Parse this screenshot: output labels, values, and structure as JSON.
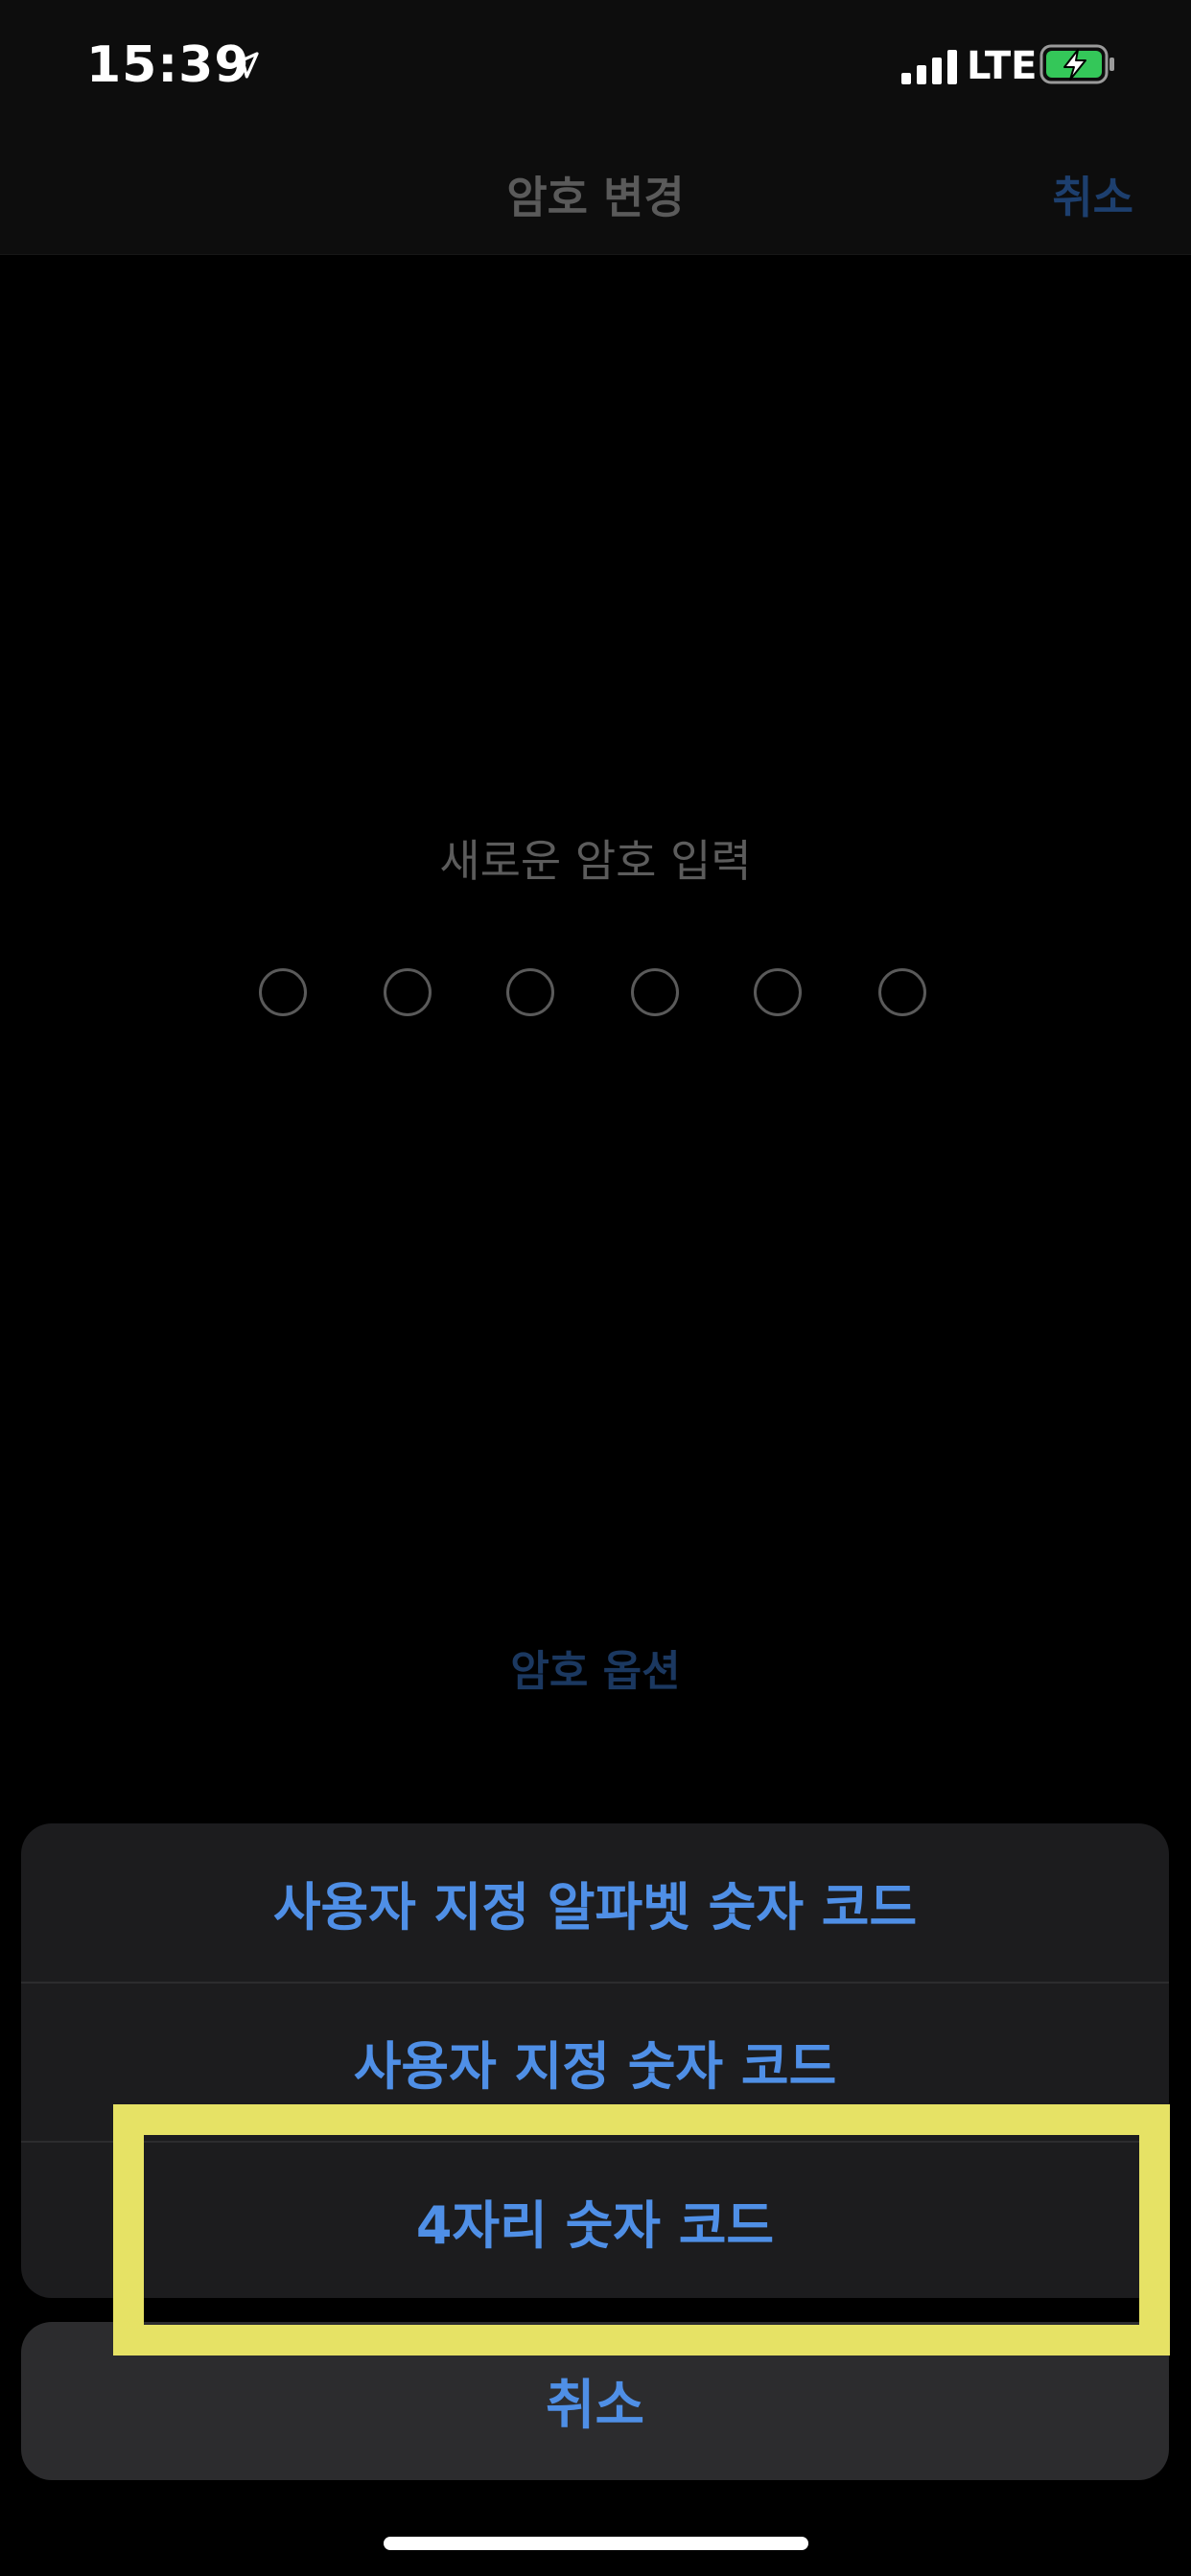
{
  "status_bar": {
    "time": "15:39",
    "network": "LTE",
    "icons": [
      "location-arrow-icon",
      "cellular-signal-icon",
      "battery-charging-icon"
    ],
    "battery_color": "#34c759"
  },
  "nav": {
    "title": "암호 변경",
    "cancel_label": "취소"
  },
  "passcode": {
    "prompt": "새로운 암호 입력",
    "digit_count": 6
  },
  "options_link": "암호 옵션",
  "action_sheet": {
    "options": [
      {
        "label": "사용자 지정 알파벳 숫자 코드"
      },
      {
        "label": "사용자 지정 숫자 코드"
      },
      {
        "label": "4자리 숫자 코드"
      }
    ],
    "cancel_label": "취소"
  },
  "colors": {
    "accent": "#4f8fe6",
    "highlight_frame": "#e6e265",
    "background": "#000000"
  }
}
